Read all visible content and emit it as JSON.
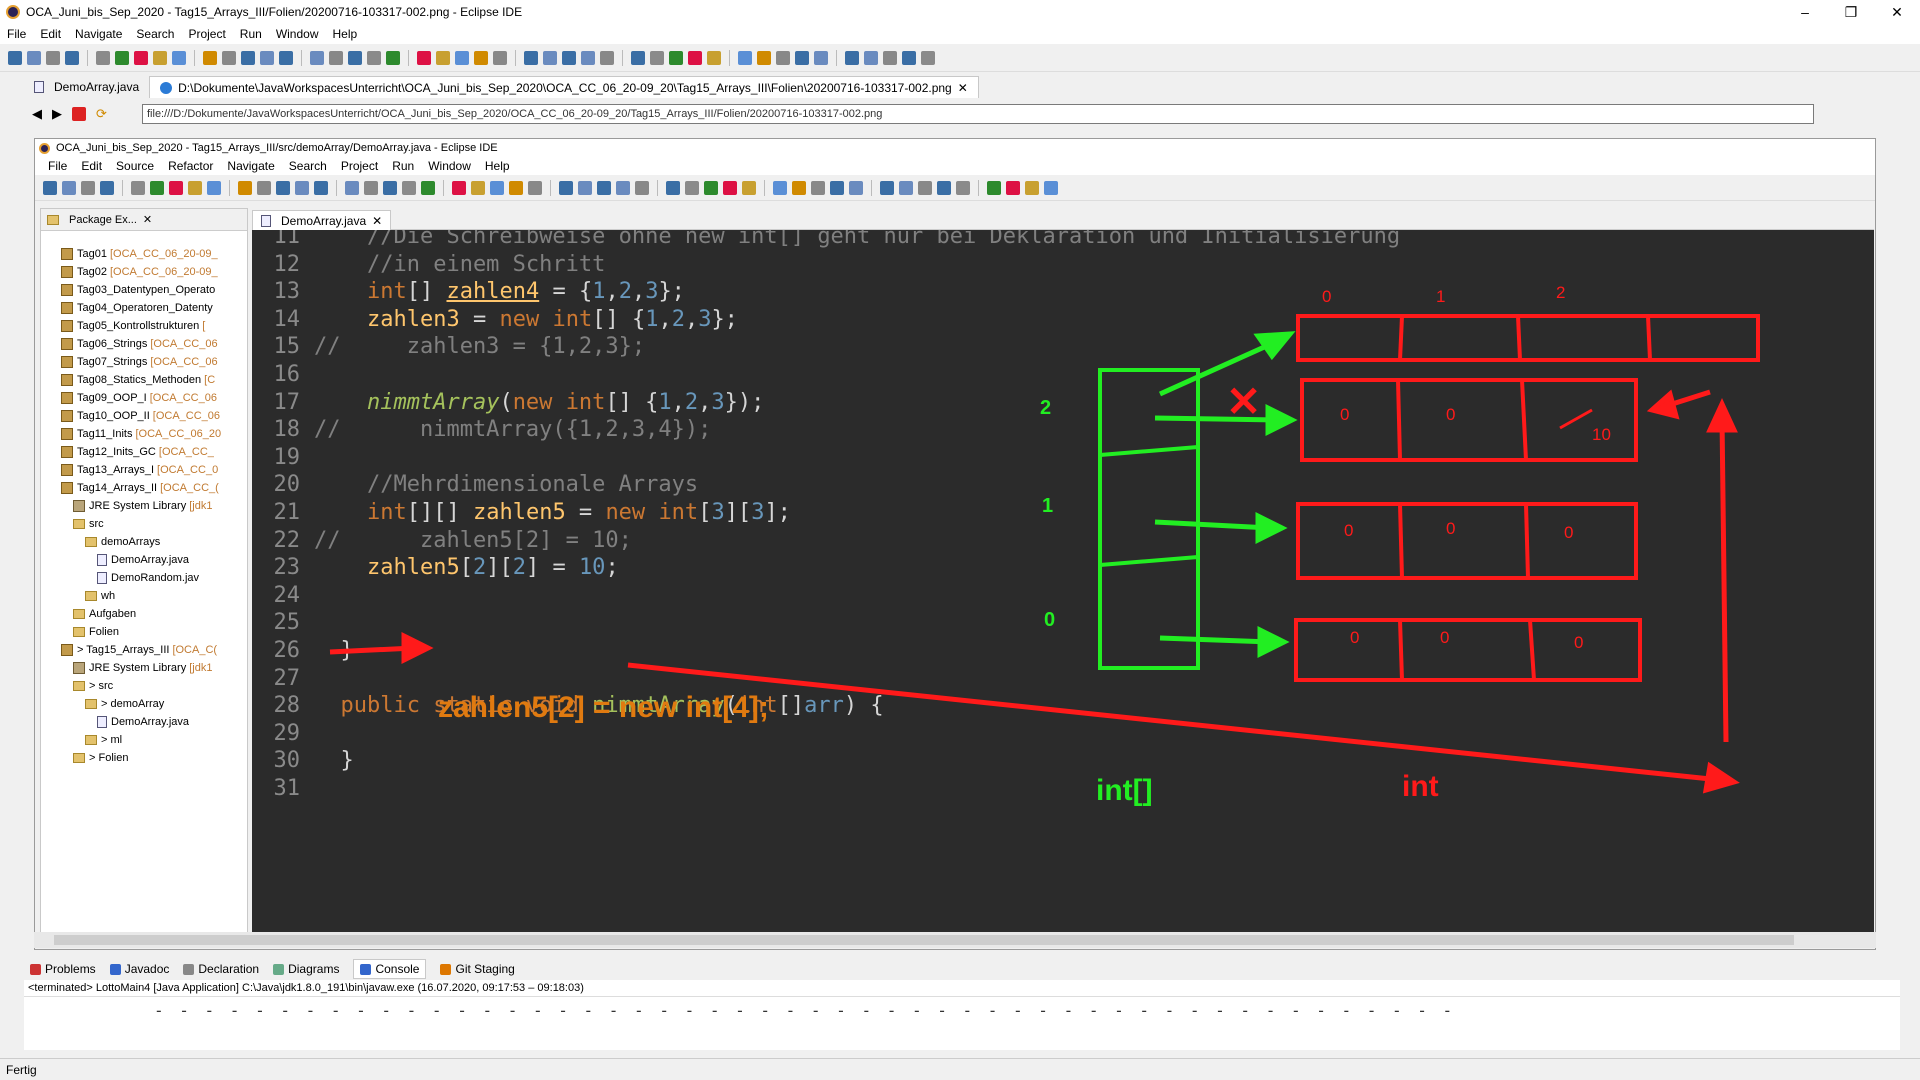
{
  "window": {
    "title": "OCA_Juni_bis_Sep_2020 - Tag15_Arrays_III/Folien/20200716-103317-002.png - Eclipse IDE"
  },
  "menu": [
    "File",
    "Edit",
    "Navigate",
    "Search",
    "Project",
    "Run",
    "Window",
    "Help"
  ],
  "tabs": [
    {
      "label": "DemoArray.java"
    },
    {
      "label": "D:\\Dokumente\\JavaWorkspacesUnterricht\\OCA_Juni_bis_Sep_2020\\OCA_CC_06_20-09_20\\Tag15_Arrays_III\\Folien\\20200716-103317-002.png"
    }
  ],
  "url": "file:///D:/Dokumente/JavaWorkspacesUnterricht/OCA_Juni_bis_Sep_2020/OCA_CC_06_20-09_20/Tag15_Arrays_III/Folien/20200716-103317-002.png",
  "inner": {
    "title": "OCA_Juni_bis_Sep_2020 - Tag15_Arrays_III/src/demoArray/DemoArray.java - Eclipse IDE",
    "menu": [
      "File",
      "Edit",
      "Source",
      "Refactor",
      "Navigate",
      "Search",
      "Project",
      "Run",
      "Window",
      "Help"
    ],
    "package_tab": "Package Ex...",
    "editor_tab": "DemoArray.java"
  },
  "tree": [
    {
      "label": "Tag01",
      "suffix": "[OCA_CC_06_20-09_",
      "indent": 0,
      "icon": "project"
    },
    {
      "label": "Tag02",
      "suffix": "[OCA_CC_06_20-09_",
      "indent": 0,
      "icon": "project"
    },
    {
      "label": "Tag03_Datentypen_Operato",
      "suffix": "",
      "indent": 0,
      "icon": "project"
    },
    {
      "label": "Tag04_Operatoren_Datenty",
      "suffix": "",
      "indent": 0,
      "icon": "project"
    },
    {
      "label": "Tag05_Kontrollstrukturen",
      "suffix": "[",
      "indent": 0,
      "icon": "project"
    },
    {
      "label": "Tag06_Strings",
      "suffix": "[OCA_CC_06",
      "indent": 0,
      "icon": "project"
    },
    {
      "label": "Tag07_Strings",
      "suffix": "[OCA_CC_06",
      "indent": 0,
      "icon": "project"
    },
    {
      "label": "Tag08_Statics_Methoden",
      "suffix": "[C",
      "indent": 0,
      "icon": "project"
    },
    {
      "label": "Tag09_OOP_I",
      "suffix": "[OCA_CC_06",
      "indent": 0,
      "icon": "project"
    },
    {
      "label": "Tag10_OOP_II",
      "suffix": "[OCA_CC_06",
      "indent": 0,
      "icon": "project"
    },
    {
      "label": "Tag11_Inits",
      "suffix": "[OCA_CC_06_20",
      "indent": 0,
      "icon": "project"
    },
    {
      "label": "Tag12_Inits_GC",
      "suffix": "[OCA_CC_",
      "indent": 0,
      "icon": "project"
    },
    {
      "label": "Tag13_Arrays_I",
      "suffix": "[OCA_CC_0",
      "indent": 0,
      "icon": "project"
    },
    {
      "label": "Tag14_Arrays_II",
      "suffix": "[OCA_CC_(",
      "indent": 0,
      "icon": "project"
    },
    {
      "label": "JRE System Library",
      "suffix": "[jdk1",
      "indent": 1,
      "icon": "lib"
    },
    {
      "label": "src",
      "suffix": "",
      "indent": 1,
      "icon": "folder"
    },
    {
      "label": "demoArrays",
      "suffix": "",
      "indent": 2,
      "icon": "folder"
    },
    {
      "label": "DemoArray.java",
      "suffix": "",
      "indent": 3,
      "icon": "java"
    },
    {
      "label": "DemoRandom.jav",
      "suffix": "",
      "indent": 3,
      "icon": "java"
    },
    {
      "label": "wh",
      "suffix": "",
      "indent": 2,
      "icon": "folder"
    },
    {
      "label": "Aufgaben",
      "suffix": "",
      "indent": 1,
      "icon": "folder"
    },
    {
      "label": "Folien",
      "suffix": "",
      "indent": 1,
      "icon": "folder"
    },
    {
      "label": "> Tag15_Arrays_III",
      "suffix": "[OCA_C(",
      "indent": 0,
      "icon": "project"
    },
    {
      "label": "JRE System Library",
      "suffix": "[jdk1",
      "indent": 1,
      "icon": "lib"
    },
    {
      "label": "> src",
      "suffix": "",
      "indent": 1,
      "icon": "folder"
    },
    {
      "label": "> demoArray",
      "suffix": "",
      "indent": 2,
      "icon": "folder"
    },
    {
      "label": "DemoArray.java",
      "suffix": "",
      "indent": 3,
      "icon": "java"
    },
    {
      "label": "> ml",
      "suffix": "",
      "indent": 2,
      "icon": "folder"
    },
    {
      "label": "> Folien",
      "suffix": "",
      "indent": 1,
      "icon": "folder"
    }
  ],
  "code": [
    {
      "n": "11",
      "html": "<span class='cm'>    //Die Schreibweise ohne new int[] geht nur bei Deklaration und Initialisierung</span>"
    },
    {
      "n": "12",
      "html": "<span class='cm'>    //in einem Schritt</span>"
    },
    {
      "n": "13",
      "html": "    <span class='kw'>int</span>[] <span class='id ul'>zahlen4</span> = {<span class='num'>1</span>,<span class='num'>2</span>,<span class='num'>3</span>};"
    },
    {
      "n": "14",
      "html": "    <span class='id'>zahlen3</span> = <span class='kw'>new</span> <span class='kw'>int</span>[] {<span class='num'>1</span>,<span class='num'>2</span>,<span class='num'>3</span>};"
    },
    {
      "n": "15",
      "html": "<span class='cm'>//     zahlen3 = {1,2,3};</span>"
    },
    {
      "n": "16",
      "html": ""
    },
    {
      "n": "17",
      "html": "    <span class='fn it'>nimmtArray</span>(<span class='kw'>new</span> <span class='kw'>int</span>[] {<span class='num'>1</span>,<span class='num'>2</span>,<span class='num'>3</span>});"
    },
    {
      "n": "18",
      "html": "<span class='cm'>//      nimmtArray({1,2,3,4});</span>"
    },
    {
      "n": "19",
      "html": ""
    },
    {
      "n": "20",
      "html": "<span class='cm'>    //Mehrdimensionale Arrays</span>"
    },
    {
      "n": "21",
      "html": "    <span class='kw'>int</span>[][] <span class='id'>zahlen5</span> = <span class='kw'>new</span> <span class='kw'>int</span>[<span class='num'>3</span>][<span class='num'>3</span>];"
    },
    {
      "n": "22",
      "html": "<span class='cm'>//      zahlen5[2] = 10;</span>"
    },
    {
      "n": "23",
      "html": "    <span class='id'>zahlen5</span>[<span class='num'>2</span>][<span class='num'>2</span>] = <span class='num'>10</span>;"
    },
    {
      "n": "24",
      "html": ""
    },
    {
      "n": "25",
      "html": ""
    },
    {
      "n": "26",
      "html": "  }"
    },
    {
      "n": "27",
      "html": ""
    },
    {
      "n": "28",
      "html": "  <span class='kw'>public static void</span> <span class='fn'>nimmtArray</span>(<span class='kw'>int</span>[]<span class='num'>arr</span>) {"
    },
    {
      "n": "29",
      "html": ""
    },
    {
      "n": "30",
      "html": "  }"
    },
    {
      "n": "31",
      "html": ""
    }
  ],
  "annotations": {
    "overlay_code": "zahlen5[2] = new int[4];",
    "int_arr_label": "int[]",
    "int_label": "int",
    "green_indices": [
      "2",
      "1",
      "0"
    ],
    "top_indices": [
      "0",
      "1",
      "2"
    ],
    "row0_values": [
      "0",
      "0",
      "10"
    ],
    "row1_values": [
      "0",
      "0",
      "0"
    ],
    "row2_values": [
      "0",
      "0",
      "0"
    ]
  },
  "console": {
    "tabs": [
      "Problems",
      "Javadoc",
      "Declaration",
      "Diagrams",
      "Console",
      "Git Staging"
    ],
    "terminated": "<terminated> LottoMain4 [Java Application] C:\\Java\\jdk1.8.0_191\\bin\\javaw.exe  (16.07.2020, 09:17:53 – 09:18:03)"
  },
  "status": "Fertig",
  "colors": {
    "green": "#22ee22",
    "red": "#ff1a1a",
    "orange": "#e07a10"
  }
}
